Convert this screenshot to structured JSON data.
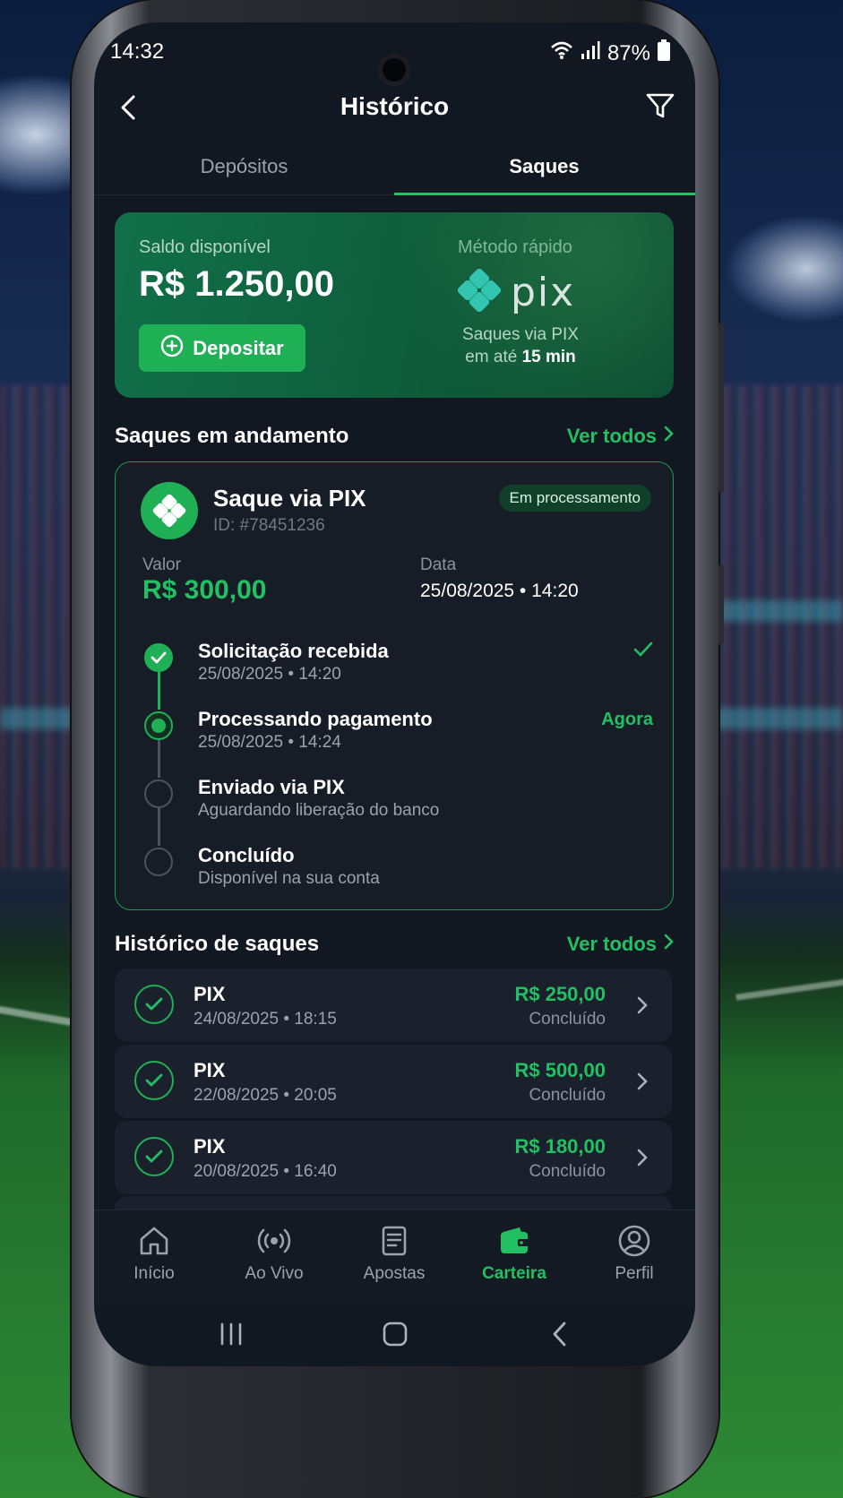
{
  "status": {
    "time": "14:32",
    "battery": "87%"
  },
  "header": {
    "title": "Histórico"
  },
  "tabs": [
    {
      "label": "Depósitos"
    },
    {
      "label": "Saques"
    }
  ],
  "balance": {
    "label": "Saldo disponível",
    "amount": "R$ 1.250,00",
    "deposit_button": "Depositar",
    "method_label": "Método rápido",
    "method_logo_text": "pix",
    "method_desc_line1": "Saques via PIX",
    "method_desc_line2_prefix": "em até ",
    "method_desc_line2_bold": "15 min"
  },
  "in_progress": {
    "section_title": "Saques em andamento",
    "see_all": "Ver todos",
    "card": {
      "title": "Saque via PIX",
      "id": "ID: #78451236",
      "badge": "Em processamento",
      "value_label": "Valor",
      "value": "R$ 300,00",
      "date_label": "Data",
      "date": "25/08/2025 • 14:20"
    },
    "steps": [
      {
        "title": "Solicitação recebida",
        "sub": "25/08/2025 • 14:20",
        "state": "done",
        "right": ""
      },
      {
        "title": "Processando pagamento",
        "sub": "25/08/2025 • 14:24",
        "state": "current",
        "right": "Agora"
      },
      {
        "title": "Enviado via PIX",
        "sub": "Aguardando liberação do banco",
        "state": "pending",
        "right": ""
      },
      {
        "title": "Concluído",
        "sub": "Disponível na sua conta",
        "state": "pending",
        "right": ""
      }
    ]
  },
  "history": {
    "section_title": "Histórico de saques",
    "see_all": "Ver todos",
    "items": [
      {
        "method": "PIX",
        "date": "24/08/2025 • 18:15",
        "amount": "R$ 250,00",
        "status": "Concluído"
      },
      {
        "method": "PIX",
        "date": "22/08/2025 • 20:05",
        "amount": "R$ 500,00",
        "status": "Concluído"
      },
      {
        "method": "PIX",
        "date": "20/08/2025 • 16:40",
        "amount": "R$ 180,00",
        "status": "Concluído"
      }
    ]
  },
  "bottom_nav": [
    {
      "label": "Início",
      "icon": "home-icon"
    },
    {
      "label": "Ao Vivo",
      "icon": "live-icon"
    },
    {
      "label": "Apostas",
      "icon": "bets-icon"
    },
    {
      "label": "Carteira",
      "icon": "wallet-icon",
      "active": true
    },
    {
      "label": "Perfil",
      "icon": "profile-icon"
    }
  ],
  "colors": {
    "accent": "#22c063",
    "card_green": "#0e5c3b",
    "background": "#121821"
  }
}
